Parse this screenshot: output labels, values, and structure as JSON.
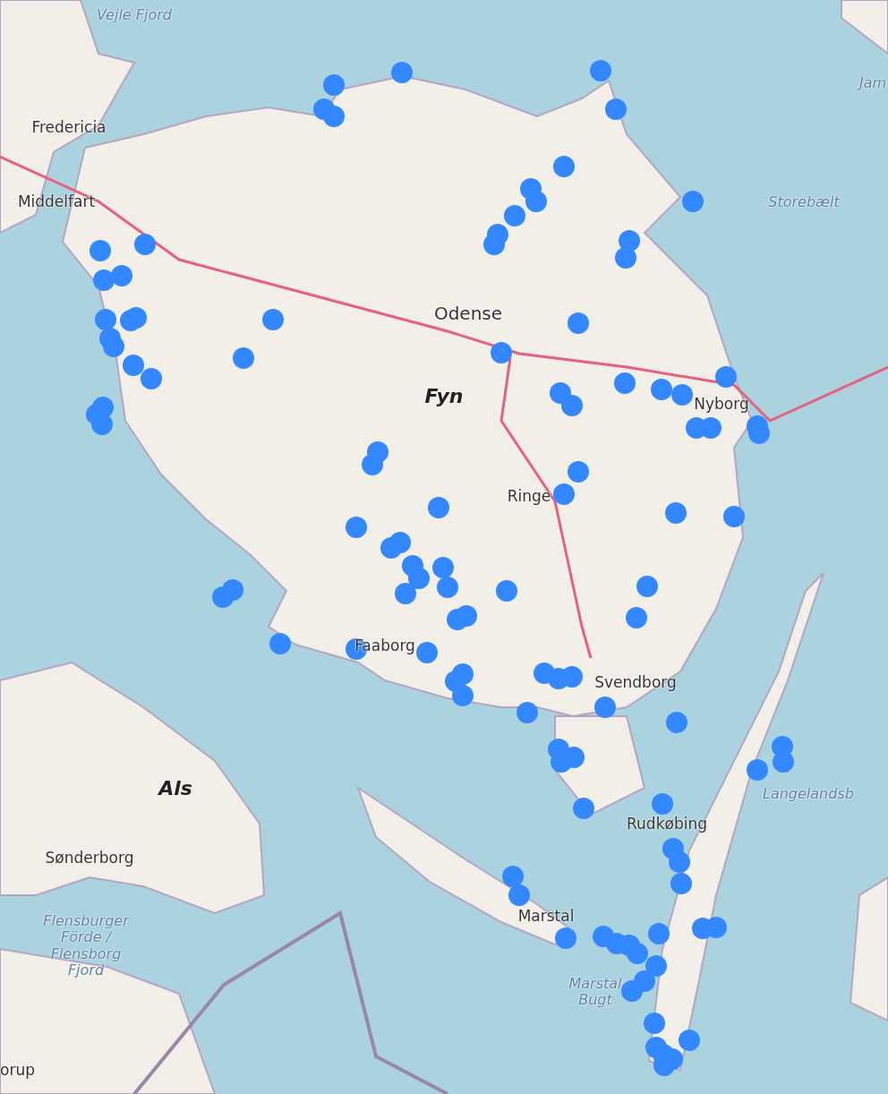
{
  "map": {
    "labels": [
      {
        "text": "Vejle Fjord",
        "kind": "water"
      },
      {
        "text": "Jam",
        "kind": "water"
      },
      {
        "text": "Fredericia",
        "kind": "place"
      },
      {
        "text": "Middelfart",
        "kind": "place"
      },
      {
        "text": "Storebælt",
        "kind": "water"
      },
      {
        "text": "Odense",
        "kind": "city"
      },
      {
        "text": "Fyn",
        "kind": "region"
      },
      {
        "text": "Nyborg",
        "kind": "place"
      },
      {
        "text": "Ringe",
        "kind": "place"
      },
      {
        "text": "Faaborg",
        "kind": "place"
      },
      {
        "text": "Svendborg",
        "kind": "place"
      },
      {
        "text": "Als",
        "kind": "region"
      },
      {
        "text": "Langelandsb",
        "kind": "water"
      },
      {
        "text": "Rudkøbing",
        "kind": "place"
      },
      {
        "text": "Sønderborg",
        "kind": "place"
      },
      {
        "text": "Marstal",
        "kind": "place"
      },
      {
        "text": "Flensburger Förde / Flensborg Fjord",
        "kind": "water"
      },
      {
        "text": "Marstal Bugt",
        "kind": "water"
      },
      {
        "text": "orup",
        "kind": "place"
      }
    ]
  }
}
